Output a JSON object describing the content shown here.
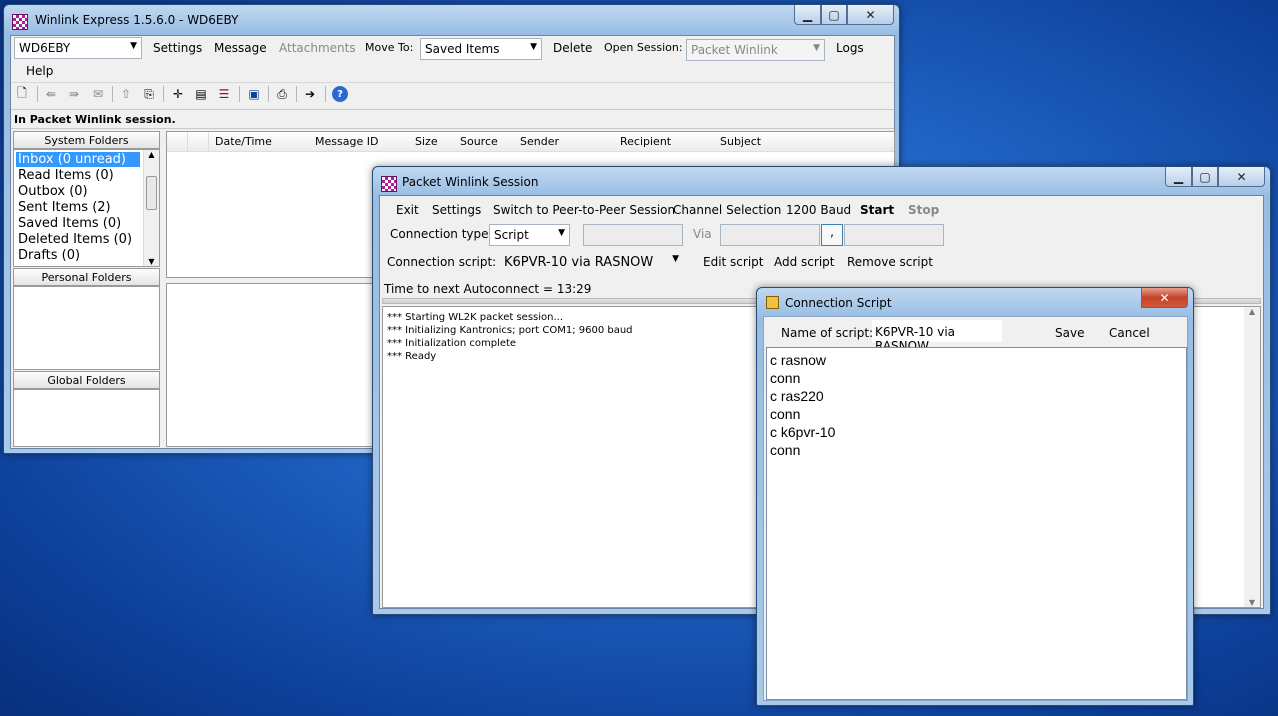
{
  "main": {
    "title": "Winlink Express 1.5.6.0 - WD6EBY",
    "callsign": "WD6EBY",
    "menu": {
      "settings": "Settings",
      "message": "Message",
      "attachments": "Attachments",
      "move_to": "Move To:",
      "move_target": "Saved Items",
      "delete": "Delete",
      "open_session": "Open Session:",
      "session_type": "Packet Winlink",
      "logs": "Logs",
      "help": "Help"
    },
    "status": "In Packet Winlink session.",
    "system_folders_header": "System Folders",
    "folders": [
      {
        "label": "Inbox  (0 unread)"
      },
      {
        "label": "Read Items  (0)"
      },
      {
        "label": "Outbox  (0)"
      },
      {
        "label": "Sent Items  (2)"
      },
      {
        "label": "Saved Items  (0)"
      },
      {
        "label": "Deleted Items  (0)"
      },
      {
        "label": "Drafts  (0)"
      }
    ],
    "personal_folders_header": "Personal Folders",
    "global_folders_header": "Global Folders",
    "columns": [
      "Date/Time",
      "Message ID",
      "Size",
      "Source",
      "Sender",
      "Recipient",
      "Subject"
    ]
  },
  "session": {
    "title": "Packet Winlink Session",
    "menu": {
      "exit": "Exit",
      "settings": "Settings",
      "p2p": "Switch to Peer-to-Peer Session",
      "channel": "Channel Selection",
      "baud": "1200 Baud",
      "start": "Start",
      "stop": "Stop"
    },
    "connection_type_label": "Connection type:",
    "connection_type_value": "Script",
    "via_label": "Via",
    "via_btn": ",",
    "connection_script_label": "Connection script:",
    "connection_script_value": "K6PVR-10 via RASNOW",
    "edit_script": "Edit script",
    "add_script": "Add script",
    "remove_script": "Remove script",
    "autoconnect": "Time to next Autoconnect = 13:29",
    "log": [
      "*** Starting WL2K packet session...",
      "*** Initializing Kantronics; port COM1; 9600 baud",
      "*** Initialization complete",
      "*** Ready"
    ]
  },
  "script_dialog": {
    "title": "Connection Script",
    "name_label": "Name of script:",
    "name_value": "K6PVR-10 via RASNOW",
    "save": "Save",
    "cancel": "Cancel",
    "lines": [
      "c rasnow",
      "conn",
      "c ras220",
      "conn",
      "c k6pvr-10",
      "conn"
    ]
  }
}
